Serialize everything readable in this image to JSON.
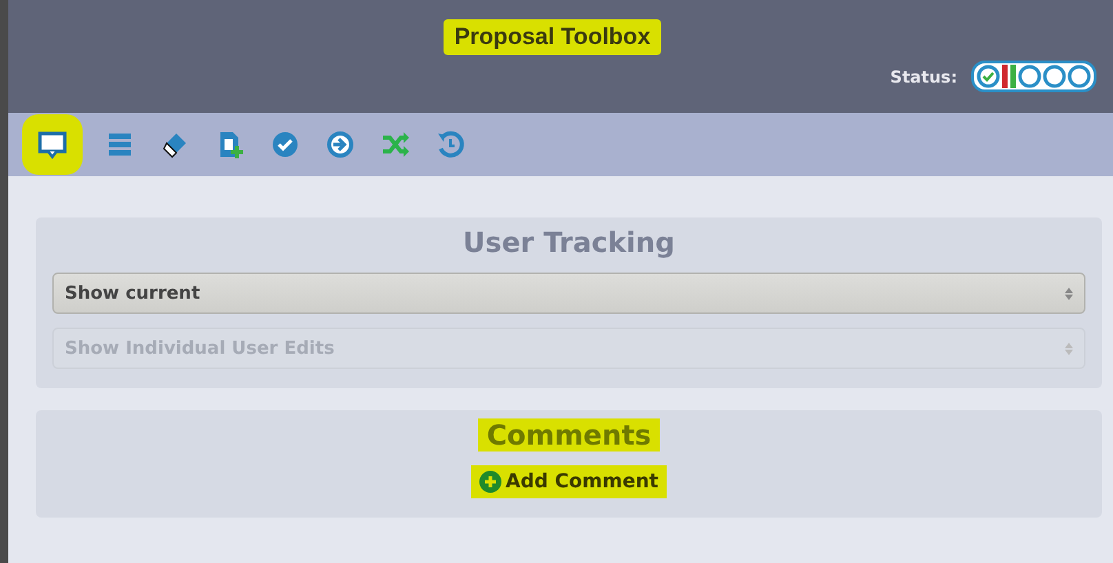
{
  "header": {
    "title": "Proposal Toolbox",
    "title_highlighted": true,
    "status_label": "Status:",
    "status_steps": [
      {
        "kind": "check"
      },
      {
        "kind": "bar",
        "color": "#d0282e"
      },
      {
        "kind": "bar",
        "color": "#3cb043"
      },
      {
        "kind": "circle"
      },
      {
        "kind": "circle"
      },
      {
        "kind": "circle"
      }
    ]
  },
  "toolbar": [
    {
      "kind": "comment",
      "selected": true
    },
    {
      "kind": "list",
      "selected": false
    },
    {
      "kind": "eraser",
      "selected": false
    },
    {
      "kind": "adddoc",
      "selected": false
    },
    {
      "kind": "check",
      "selected": false
    },
    {
      "kind": "arrow",
      "selected": false
    },
    {
      "kind": "shuffle",
      "selected": false
    },
    {
      "kind": "history",
      "selected": false
    }
  ],
  "user_tracking": {
    "title": "User Tracking",
    "selects": [
      {
        "value": "Show current",
        "disabled": false
      },
      {
        "value": "Show Individual User Edits",
        "disabled": true
      }
    ]
  },
  "comments": {
    "title": "Comments",
    "highlighted": true,
    "add_button": "Add Comment"
  }
}
